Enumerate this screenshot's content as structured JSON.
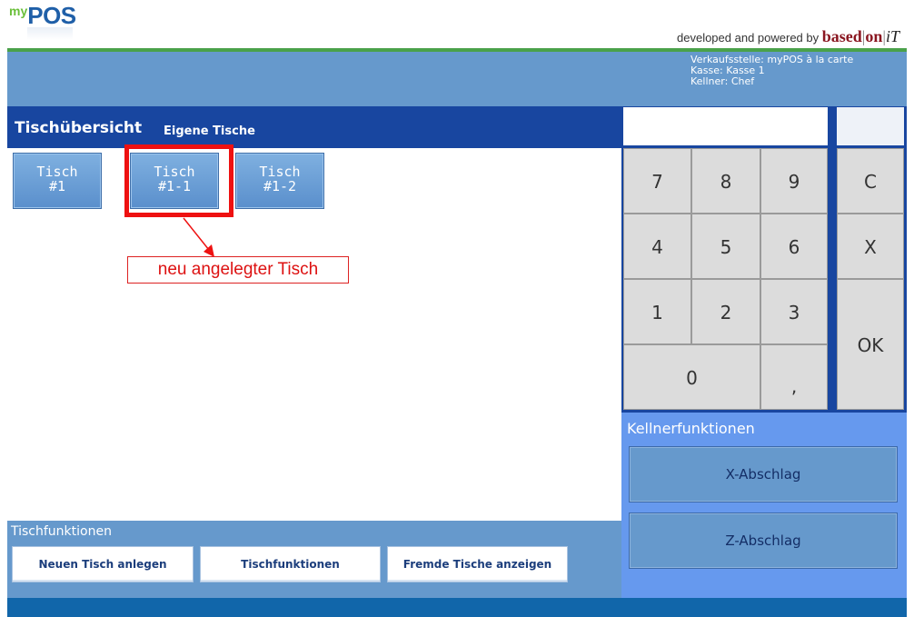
{
  "header": {
    "logo_my": "my",
    "logo_pos": "POS",
    "powered_text": "developed and powered by ",
    "brand_based": "based",
    "brand_on": "on",
    "brand_it": "iT"
  },
  "info": {
    "line1": "Verkaufsstelle: myPOS à la carte",
    "line2": "Kasse: Kasse 1",
    "line3": "Kellner: Chef"
  },
  "titlebar": {
    "title": "Tischübersicht",
    "subtitle": "Eigene Tische"
  },
  "tables": [
    {
      "line1": "Tisch",
      "line2": "#1"
    },
    {
      "line1": "Tisch",
      "line2": "#1-1"
    },
    {
      "line1": "Tisch",
      "line2": "#1-2"
    }
  ],
  "annotation": "neu angelegter Tisch",
  "tischfunktionen": {
    "title": "Tischfunktionen",
    "buttons": [
      "Neuen Tisch anlegen",
      "Tischfunktionen",
      "Fremde Tische anzeigen"
    ]
  },
  "keypad": {
    "k7": "7",
    "k8": "8",
    "k9": "9",
    "kc": "C",
    "k4": "4",
    "k5": "5",
    "k6": "6",
    "kx": "X",
    "k1": "1",
    "k2": "2",
    "k3": "3",
    "kok": "OK",
    "k0": "0",
    "kcomma": ","
  },
  "kellner": {
    "title": "Kellnerfunktionen",
    "buttons": [
      "X-Abschlag",
      "Z-Abschlag"
    ]
  },
  "colors": {
    "accent_blue": "#1846a0",
    "panel_blue": "#6699cc",
    "highlight_red": "#ee1111"
  }
}
